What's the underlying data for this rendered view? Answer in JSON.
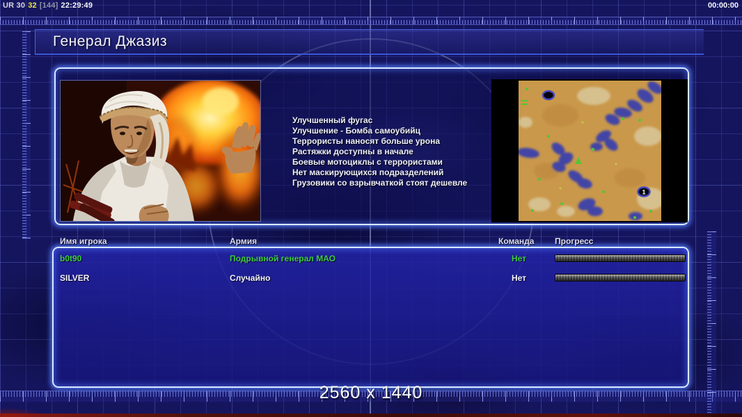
{
  "status_bar": {
    "left_label": "UR 30",
    "left_value": "32",
    "left_bracket": "[144]",
    "left_clock": "22:29:49",
    "right_clock": "00:00:00"
  },
  "header": {
    "title": "Генерал Джазиз"
  },
  "general": {
    "bonuses": [
      "Улучшенный фугас",
      "Улучшение - Бомба самоубийц",
      "Террористы наносят больше урона",
      "Растяжки доступны в начале",
      "Боевые мотоциклы с террористами",
      "Нет маскирующихся подразделений",
      "Грузовики со взрывчаткой стоят дешевле"
    ]
  },
  "minimap": {
    "marker_label": "1"
  },
  "players": {
    "columns": {
      "name": "Имя игрока",
      "army": "Армия",
      "team": "Команда",
      "progress": "Прогресс"
    },
    "rows": [
      {
        "name": "b0t90",
        "army": "Подрывной генерал МАО",
        "team": "Нет",
        "color": "#3ecb3e",
        "progress_percent": 0
      },
      {
        "name": "SILVER",
        "army": "Случайно",
        "team": "Нет",
        "color": "#f2f2f8",
        "progress_percent": 0
      }
    ]
  },
  "footer": {
    "resolution": "2560 x 1440"
  },
  "colors": {
    "accent_green": "#3ecb3e",
    "panel_glow": "#d9e9ff",
    "background": "#15155e"
  }
}
